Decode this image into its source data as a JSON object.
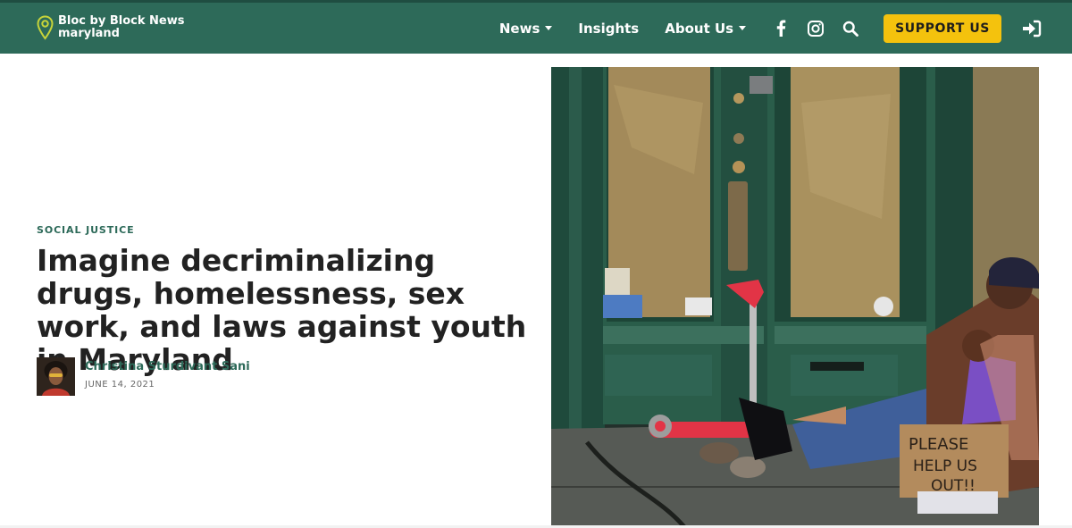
{
  "header": {
    "logo_line1": "Bloc by Block News",
    "logo_line2": "maryland",
    "nav": [
      {
        "label": "News",
        "has_caret": true
      },
      {
        "label": "Insights",
        "has_caret": false
      },
      {
        "label": "About Us",
        "has_caret": true
      }
    ],
    "icons": [
      "facebook-icon",
      "instagram-icon",
      "search-icon",
      "login-icon"
    ],
    "support_label": "SUPPORT US"
  },
  "article": {
    "category": "SOCIAL JUSTICE",
    "title": "Imagine decriminalizing drugs, homelessness, sex work, and laws against youth in Maryland",
    "author": "Christina Sturdivant Sani",
    "date": "JUNE 14, 2021",
    "hero_sign_text": [
      "PLEASE",
      "HELP US",
      "OUT!!"
    ]
  },
  "colors": {
    "brand_green": "#2d6a59",
    "accent_yellow": "#f4c20d"
  }
}
